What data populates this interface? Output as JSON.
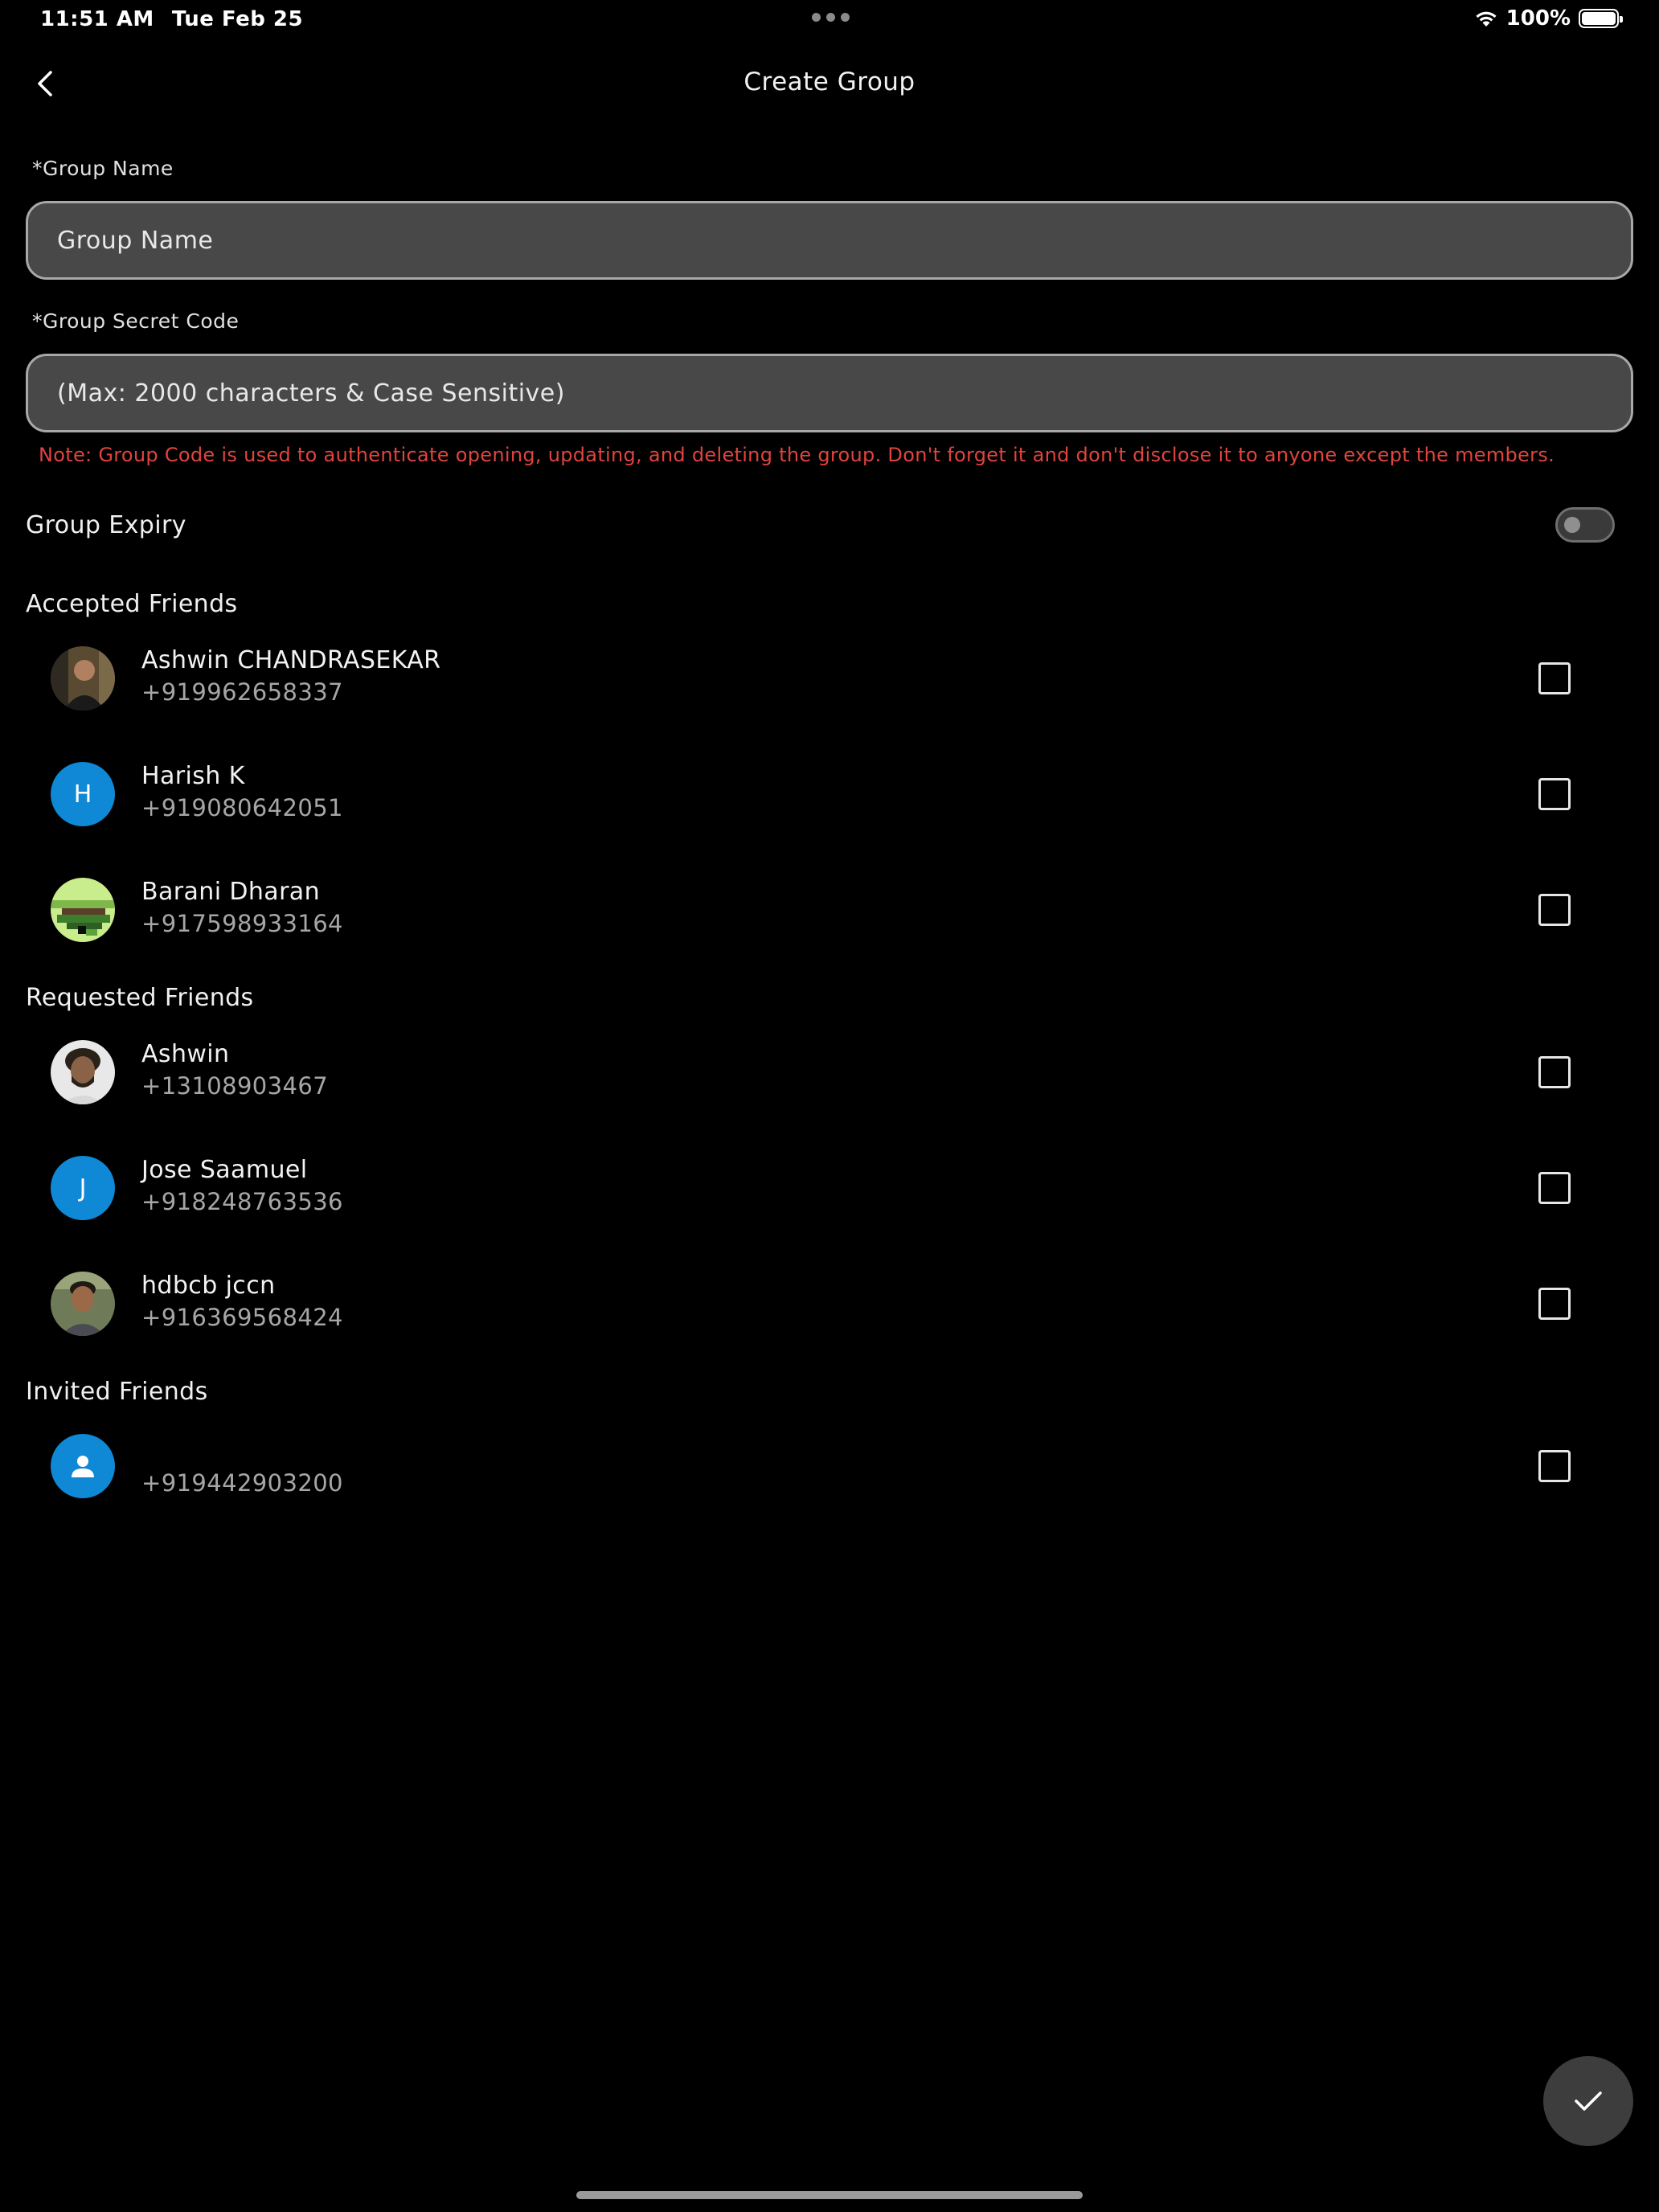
{
  "status_bar": {
    "time": "11:51 AM",
    "date": "Tue Feb 25",
    "battery": "100%",
    "icons": [
      "more-dots-icon",
      "wifi-icon",
      "battery-icon"
    ]
  },
  "header": {
    "title": "Create Group",
    "back_icon": "chevron-left-icon"
  },
  "form": {
    "group_name_label": "*Group Name",
    "group_name_placeholder": "Group Name",
    "group_name_value": "",
    "secret_code_label": "*Group Secret Code",
    "secret_code_placeholder": "(Max: 2000 characters & Case Sensitive)",
    "secret_code_value": "",
    "note": "Note: Group Code is used to authenticate opening, updating, and deleting the group. Don't forget it and don't disclose it to anyone except the members.",
    "note_color": "#e0443e",
    "expiry_label": "Group Expiry",
    "expiry_enabled": false
  },
  "sections": {
    "accepted": {
      "title": "Accepted Friends",
      "items": [
        {
          "name": "Ashwin CHANDRASEKAR",
          "phone": "+919962658337",
          "avatar": "photo",
          "checked": false
        },
        {
          "name": "Harish K",
          "phone": "+919080642051",
          "avatar": "letter",
          "letter": "H",
          "checked": false
        },
        {
          "name": "Barani Dharan",
          "phone": "+917598933164",
          "avatar": "pixel",
          "checked": false
        }
      ]
    },
    "requested": {
      "title": "Requested Friends",
      "items": [
        {
          "name": "Ashwin",
          "phone": "+13108903467",
          "avatar": "photo",
          "checked": false
        },
        {
          "name": "Jose Saamuel",
          "phone": "+918248763536",
          "avatar": "letter",
          "letter": "J",
          "checked": false
        },
        {
          "name": "hdbcb jccn",
          "phone": "+916369568424",
          "avatar": "photo",
          "checked": false
        }
      ]
    },
    "invited": {
      "title": "Invited Friends",
      "items": [
        {
          "name": "",
          "phone": "+919442903200",
          "avatar": "person-icon",
          "checked": false
        }
      ]
    }
  },
  "colors": {
    "background": "#000000",
    "input_background": "#484848",
    "avatar_blue": "#0f88d6",
    "fab_background": "#3d3d3d"
  },
  "fab": {
    "icon": "checkmark-icon"
  }
}
